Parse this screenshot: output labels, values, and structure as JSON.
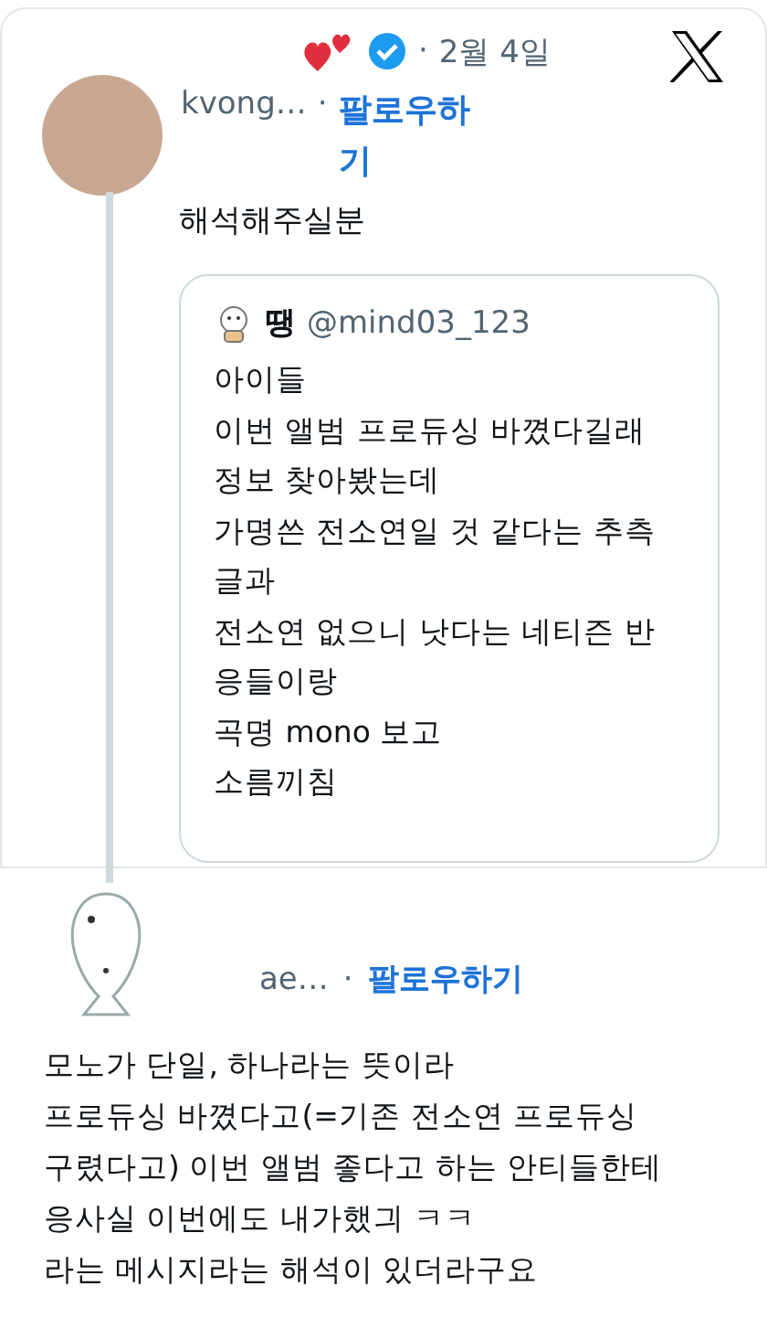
{
  "quote_tweet": {
    "handle": "kvong…",
    "separator": "·",
    "date": "2월 4일",
    "follow": "팔로우하기",
    "text": "해석해주실분",
    "quoted": {
      "name": "땡",
      "handle": "@mind03_123",
      "lines": [
        "아이들",
        "이번 앨범 프로듀싱 바꼈다길래",
        "정보 찾아봤는데",
        "가명쓴 전소연일 것 같다는 추측",
        "글과",
        "전소연 없으니 낫다는 네티즌 반",
        "응들이랑",
        "곡명 mono 보고",
        "소름끼침"
      ]
    }
  },
  "reply_tweet": {
    "handle": "ae…",
    "separator": "·",
    "follow": "팔로우하기",
    "lines": [
      "모노가 단일, 하나라는 뜻이라",
      "프로듀싱 바꼈다고(=기존 전소연 프로듀싱",
      "구렸다고) 이번 앨범 좋다고 하는 안티들한테",
      "응사실 이번에도 내가했긔 ㅋㅋ",
      "라는 메시지라는 해석이 있더라구요"
    ]
  }
}
